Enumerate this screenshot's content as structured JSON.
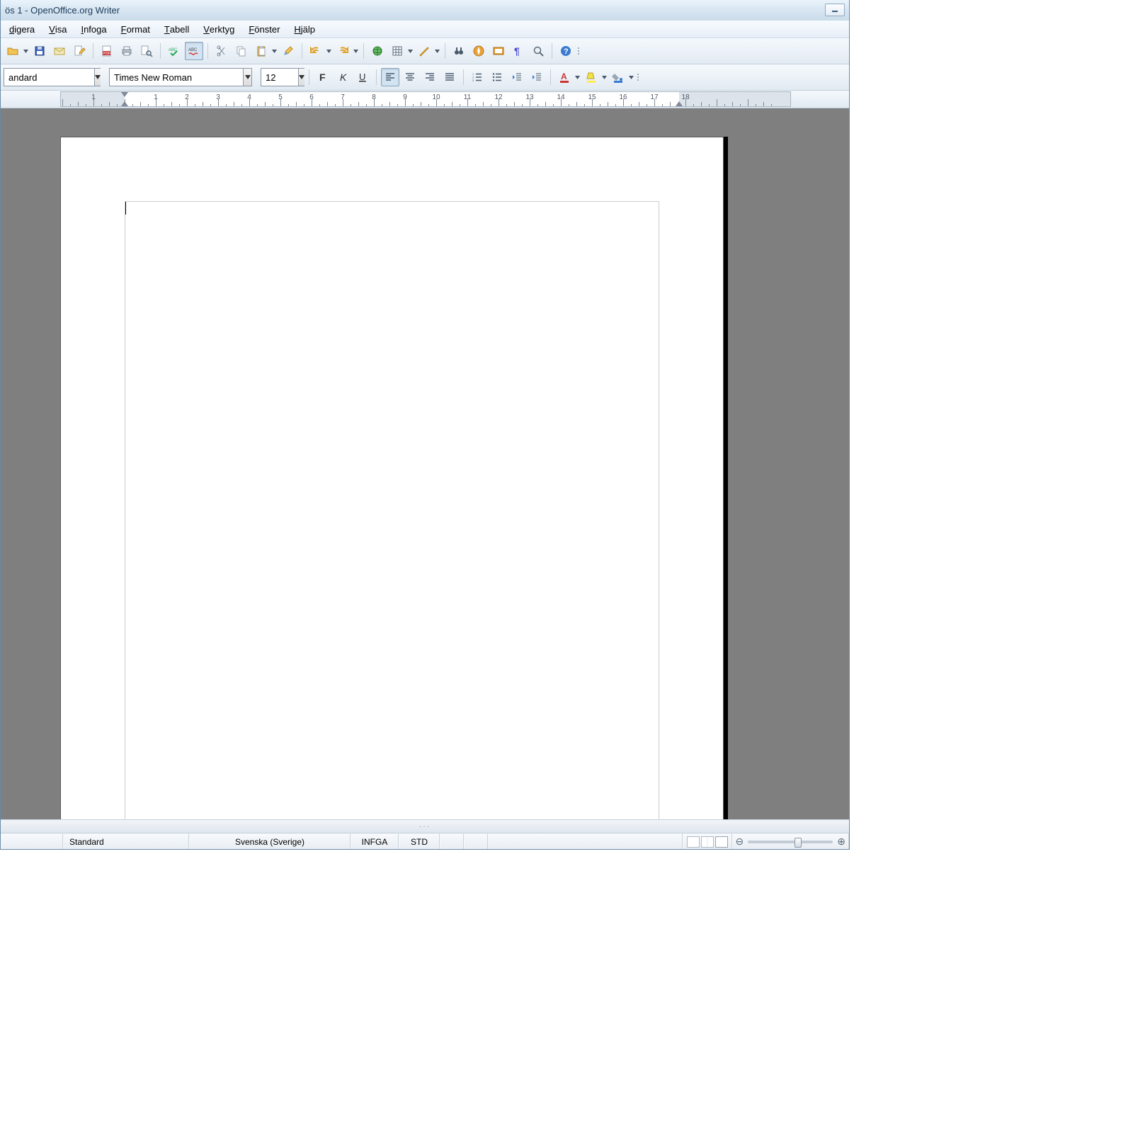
{
  "window": {
    "title": "ös 1 - OpenOffice.org Writer"
  },
  "menus": [
    {
      "label": "digera",
      "hot": "d"
    },
    {
      "label": "Visa",
      "hot": "V"
    },
    {
      "label": "Infoga",
      "hot": "I"
    },
    {
      "label": "Format",
      "hot": "F"
    },
    {
      "label": "Tabell",
      "hot": "T"
    },
    {
      "label": "Verktyg",
      "hot": "V"
    },
    {
      "label": "Fönster",
      "hot": "F"
    },
    {
      "label": "Hjälp",
      "hot": "H"
    }
  ],
  "toolbar1": {
    "groups": [
      {
        "items": [
          {
            "name": "open-button",
            "icon": "folder-open",
            "dd": true
          },
          {
            "name": "save-button",
            "icon": "floppy"
          },
          {
            "name": "email-button",
            "icon": "mail"
          },
          {
            "name": "edit-mode-button",
            "icon": "pencil-doc"
          }
        ]
      },
      {
        "items": [
          {
            "name": "export-pdf-button",
            "icon": "pdf"
          },
          {
            "name": "print-button",
            "icon": "printer"
          },
          {
            "name": "print-preview-button",
            "icon": "magnifier-page"
          }
        ]
      },
      {
        "items": [
          {
            "name": "spellcheck-button",
            "icon": "abc-check"
          },
          {
            "name": "auto-spellcheck-button",
            "icon": "abc-red",
            "active": true
          }
        ]
      },
      {
        "items": [
          {
            "name": "cut-button",
            "icon": "scissors"
          },
          {
            "name": "copy-button",
            "icon": "copy"
          },
          {
            "name": "paste-button",
            "icon": "clipboard",
            "dd": true
          },
          {
            "name": "format-paintbrush-button",
            "icon": "paintbrush"
          }
        ]
      },
      {
        "items": [
          {
            "name": "undo-button",
            "icon": "undo",
            "dd": true
          },
          {
            "name": "redo-button",
            "icon": "redo",
            "dd": true
          }
        ]
      },
      {
        "items": [
          {
            "name": "hyperlink-button",
            "icon": "globe"
          },
          {
            "name": "insert-table-button",
            "icon": "grid",
            "dd": true
          },
          {
            "name": "draw-functions-button",
            "icon": "pencil-line",
            "dd": true
          }
        ]
      },
      {
        "items": [
          {
            "name": "find-replace-button",
            "icon": "binoculars"
          },
          {
            "name": "navigator-button",
            "icon": "compass"
          },
          {
            "name": "gallery-button",
            "icon": "gallery"
          },
          {
            "name": "nonprinting-chars-button",
            "icon": "pilcrow"
          },
          {
            "name": "zoom-button",
            "icon": "magnifier"
          }
        ]
      },
      {
        "items": [
          {
            "name": "help-button",
            "icon": "help"
          }
        ]
      }
    ]
  },
  "toolbar2": {
    "style_combo": {
      "value": "andard",
      "name": "paragraph-style-combo"
    },
    "font_combo": {
      "value": "Times New Roman",
      "name": "font-name-combo"
    },
    "size_combo": {
      "value": "12",
      "name": "font-size-combo"
    },
    "buttons_a": [
      {
        "name": "bold-button",
        "icon": "bold"
      },
      {
        "name": "italic-button",
        "icon": "italic"
      },
      {
        "name": "underline-button",
        "icon": "underline"
      }
    ],
    "buttons_b": [
      {
        "name": "align-left-button",
        "icon": "align-left",
        "active": true
      },
      {
        "name": "align-center-button",
        "icon": "align-center"
      },
      {
        "name": "align-right-button",
        "icon": "align-right"
      },
      {
        "name": "align-justify-button",
        "icon": "align-justify"
      }
    ],
    "buttons_c": [
      {
        "name": "numbered-list-button",
        "icon": "num-list"
      },
      {
        "name": "bullet-list-button",
        "icon": "bul-list"
      },
      {
        "name": "decrease-indent-button",
        "icon": "outdent"
      },
      {
        "name": "increase-indent-button",
        "icon": "indent"
      }
    ],
    "buttons_d": [
      {
        "name": "font-color-button",
        "icon": "font-color",
        "dd": true
      },
      {
        "name": "highlight-color-button",
        "icon": "highlight",
        "dd": true
      },
      {
        "name": "background-color-button",
        "icon": "bg-color",
        "dd": true
      }
    ]
  },
  "ruler": {
    "unit_marks": [
      -1,
      1,
      2,
      3,
      4,
      5,
      6,
      7,
      8,
      9,
      10,
      11,
      12,
      13,
      14,
      15,
      16,
      17,
      18
    ],
    "left_margin_cm": 2.0,
    "right_margin_cm": 17.8
  },
  "statusbar": {
    "page_section": "",
    "style": "Standard",
    "language": "Svenska (Sverige)",
    "insert_mode": "INFGA",
    "sel_mode": "STD"
  }
}
